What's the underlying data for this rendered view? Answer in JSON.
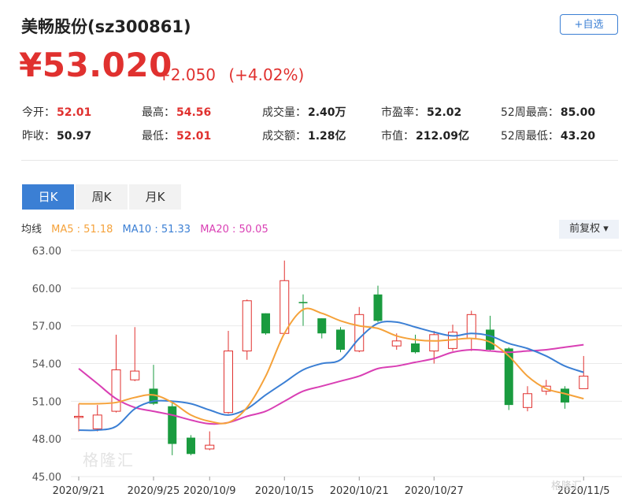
{
  "header": {
    "title": "美畅股份(sz300861)",
    "fav_label": "+自选",
    "price": "¥53.020",
    "change": "+2.050",
    "change_pct": "(+4.02%)"
  },
  "stats": [
    {
      "label": "今开：",
      "value": "52.01",
      "tone": "up"
    },
    {
      "label": "最高：",
      "value": "54.56",
      "tone": "up"
    },
    {
      "label": "成交量：",
      "value": "2.40万",
      "tone": "eq"
    },
    {
      "label": "市盈率：",
      "value": "52.02",
      "tone": "eq"
    },
    {
      "label": "52周最高：",
      "value": "85.00",
      "tone": "eq"
    },
    {
      "label": "昨收：",
      "value": "50.97",
      "tone": "eq"
    },
    {
      "label": "最低：",
      "value": "52.01",
      "tone": "up"
    },
    {
      "label": "成交额：",
      "value": "1.28亿",
      "tone": "eq"
    },
    {
      "label": "市值：",
      "value": "212.09亿",
      "tone": "eq"
    },
    {
      "label": "52周最低：",
      "value": "43.20",
      "tone": "eq"
    }
  ],
  "tabs": [
    "日K",
    "周K",
    "月K"
  ],
  "active_tab": 0,
  "ma_legend": {
    "title": "均线",
    "items": [
      {
        "text": "MA5 : 51.18",
        "color": "#f5a23a"
      },
      {
        "text": "MA10 : 51.33",
        "color": "#3b7fd4"
      },
      {
        "text": "MA20 : 50.05",
        "color": "#d93fb4"
      }
    ]
  },
  "adjust_label": "前复权 ▾",
  "watermark": "格隆汇",
  "watermark_small": "格隆汇",
  "colors": {
    "up": "#e0312f",
    "down": "#1a9b3f",
    "accent": "#3b7fd4"
  },
  "chart_data": {
    "type": "candlestick",
    "y_ticks": [
      "63.00",
      "60.00",
      "57.00",
      "54.00",
      "51.00",
      "48.00",
      "45.00"
    ],
    "ylim": [
      45,
      63
    ],
    "x_ticks": [
      {
        "label": "2020/9/21",
        "index": 0
      },
      {
        "label": "2020/9/25",
        "index": 4
      },
      {
        "label": "2020/10/9",
        "index": 7
      },
      {
        "label": "2020/10/15",
        "index": 11
      },
      {
        "label": "2020/10/21",
        "index": 15
      },
      {
        "label": "2020/10/27",
        "index": 19
      },
      {
        "label": "2020/11/5",
        "index": 27
      }
    ],
    "candles": [
      {
        "open": 49.8,
        "close": 49.8,
        "high": 50.8,
        "low": 48.6
      },
      {
        "open": 48.8,
        "close": 49.9,
        "high": 50.7,
        "low": 48.6
      },
      {
        "open": 50.2,
        "close": 53.5,
        "high": 56.3,
        "low": 50.1
      },
      {
        "open": 52.7,
        "close": 53.4,
        "high": 56.9,
        "low": 52.6
      },
      {
        "open": 52.0,
        "close": 50.8,
        "high": 53.9,
        "low": 50.7
      },
      {
        "open": 50.6,
        "close": 47.6,
        "high": 51.0,
        "low": 46.7
      },
      {
        "open": 48.1,
        "close": 46.8,
        "high": 48.3,
        "low": 46.7
      },
      {
        "open": 47.2,
        "close": 47.5,
        "high": 48.6,
        "low": 47.1
      },
      {
        "open": 50.1,
        "close": 55.0,
        "high": 56.6,
        "low": 50.0
      },
      {
        "open": 55.0,
        "close": 59.0,
        "high": 59.1,
        "low": 54.3
      },
      {
        "open": 58.0,
        "close": 56.4,
        "high": 58.0,
        "low": 56.3
      },
      {
        "open": 56.4,
        "close": 60.6,
        "high": 62.2,
        "low": 56.3
      },
      {
        "open": 58.9,
        "close": 58.8,
        "high": 59.5,
        "low": 57.0
      },
      {
        "open": 57.6,
        "close": 56.4,
        "high": 57.6,
        "low": 56.0
      },
      {
        "open": 56.7,
        "close": 55.1,
        "high": 56.9,
        "low": 54.9
      },
      {
        "open": 55.0,
        "close": 57.9,
        "high": 58.5,
        "low": 54.9
      },
      {
        "open": 59.5,
        "close": 57.4,
        "high": 60.2,
        "low": 57.3
      },
      {
        "open": 55.4,
        "close": 55.8,
        "high": 56.4,
        "low": 55.1
      },
      {
        "open": 55.6,
        "close": 54.9,
        "high": 56.3,
        "low": 54.8
      },
      {
        "open": 55.0,
        "close": 56.3,
        "high": 56.6,
        "low": 54.0
      },
      {
        "open": 55.2,
        "close": 56.5,
        "high": 57.1,
        "low": 55.0
      },
      {
        "open": 56.0,
        "close": 57.9,
        "high": 58.2,
        "low": 55.0
      },
      {
        "open": 56.7,
        "close": 55.1,
        "high": 57.8,
        "low": 55.0
      },
      {
        "open": 55.2,
        "close": 50.7,
        "high": 55.3,
        "low": 50.3
      },
      {
        "open": 50.5,
        "close": 51.6,
        "high": 52.2,
        "low": 50.2
      },
      {
        "open": 51.8,
        "close": 52.2,
        "high": 52.7,
        "low": 51.5
      },
      {
        "open": 52.0,
        "close": 50.9,
        "high": 52.2,
        "low": 50.4
      },
      {
        "open": 52.0,
        "close": 53.0,
        "high": 54.6,
        "low": 52.0
      }
    ],
    "ma5": [
      50.8,
      50.8,
      50.9,
      51.3,
      51.5,
      50.9,
      49.9,
      49.4,
      49.3,
      50.5,
      53.0,
      56.4,
      58.3,
      58.0,
      57.4,
      57.0,
      56.8,
      56.2,
      55.9,
      55.8,
      55.9,
      56.0,
      55.7,
      54.6,
      53.0,
      52.0,
      51.6,
      51.2
    ],
    "ma10": [
      48.7,
      48.7,
      49.0,
      50.4,
      51.0,
      51.0,
      50.8,
      50.3,
      49.9,
      50.4,
      51.5,
      52.5,
      53.5,
      54.0,
      54.3,
      56.0,
      57.2,
      57.3,
      56.9,
      56.5,
      56.2,
      56.4,
      56.2,
      55.6,
      55.2,
      54.6,
      53.8,
      53.3
    ],
    "ma20": [
      53.6,
      52.4,
      51.2,
      50.5,
      50.2,
      49.9,
      49.5,
      49.2,
      49.3,
      49.8,
      50.2,
      51.0,
      51.8,
      52.2,
      52.6,
      53.0,
      53.6,
      53.8,
      54.1,
      54.4,
      54.9,
      55.1,
      55.0,
      54.9,
      55.0,
      55.1,
      55.3,
      55.5
    ]
  }
}
